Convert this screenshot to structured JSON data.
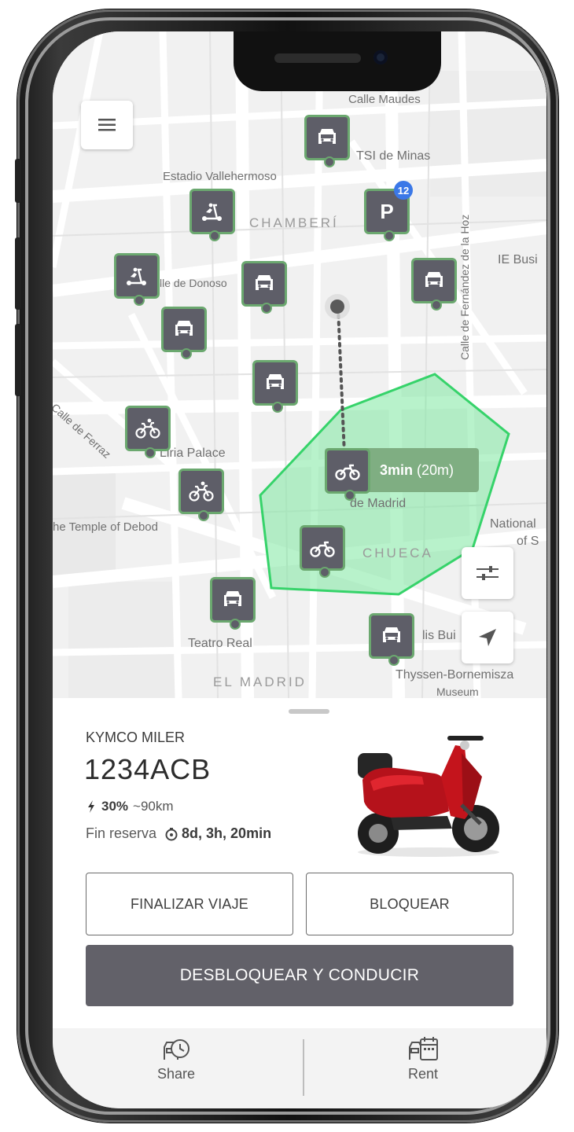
{
  "map": {
    "labels": {
      "calle_maudes": "Calle Maudes",
      "tsi_minas": "TSI de Minas",
      "estadio": "Estadio Vallehermoso",
      "chamberi": "CHAMBERÍ",
      "calle_fernandez": "Calle de Fernández de la Hoz",
      "ie_business": "IE Busi",
      "donoso": "lle de Donoso",
      "calle_ferraz": "Calle de Ferraz",
      "liria": "Liria Palace",
      "madrid_de": "de Madrid",
      "temple": "he Temple of Debod",
      "national": "National",
      "of_s": "of S",
      "chueca": "CHUECA",
      "teatro_real": "Teatro Real",
      "m_bui": "M",
      "lis_bui": "lis Bui",
      "thyssen": "Thyssen-Bornemisza",
      "museum": "Museum",
      "el_madrid": "EL MADRID"
    },
    "parking_badge": "12",
    "parking_letter": "P",
    "route_time": "3min",
    "route_distance": "(20m)",
    "zone_color": "#7ee8a0"
  },
  "vehicle": {
    "model": "KYMCO MILER",
    "plate": "1234ACB",
    "battery_pct": "30%",
    "range": "~90km",
    "reserve_label": "Fin reserva",
    "reserve_time": "8d, 3h, 20min"
  },
  "actions": {
    "finish_trip": "FINALIZAR VIAJE",
    "lock": "BLOQUEAR",
    "unlock_drive": "DESBLOQUEAR Y CONDUCIR"
  },
  "nav": {
    "share": "Share",
    "rent": "Rent"
  },
  "colors": {
    "pin_bg": "#5e5e68",
    "pin_border": "#6ba86f",
    "primary_button": "#626169",
    "route_tip": "#7fae82"
  }
}
